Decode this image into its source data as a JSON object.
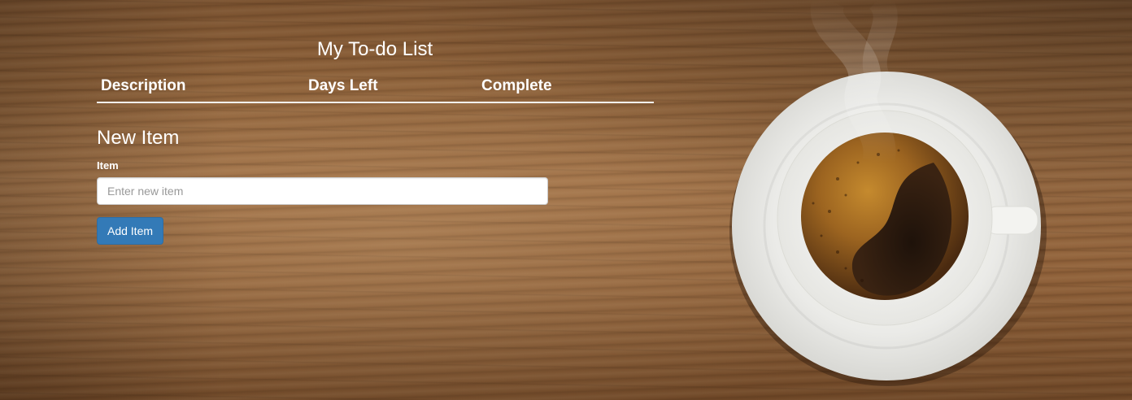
{
  "page": {
    "title": "My To-do List"
  },
  "table": {
    "columns": [
      "Description",
      "Days Left",
      "Complete"
    ]
  },
  "form": {
    "heading": "New Item",
    "item_label": "Item",
    "item_placeholder": "Enter new item",
    "item_value": "",
    "submit_label": "Add Item"
  },
  "colors": {
    "primary_button": "#337ab7",
    "text": "#ffffff",
    "background_wood": "#8b5f38"
  },
  "decoration": {
    "image": "coffee-cup-on-wooden-table"
  }
}
